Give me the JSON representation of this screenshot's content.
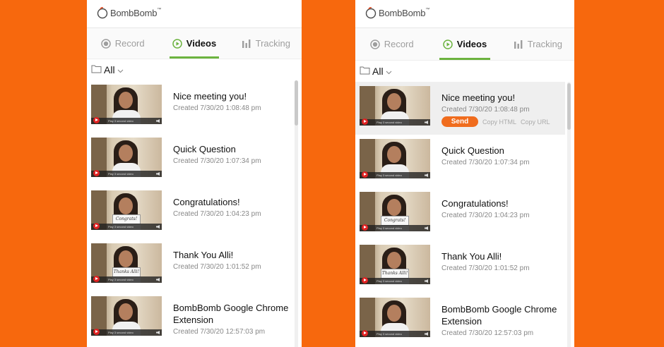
{
  "brand": {
    "name": "BombBomb",
    "trademark": "™"
  },
  "tabs": [
    {
      "label": "Record",
      "icon": "record-icon"
    },
    {
      "label": "Videos",
      "icon": "play-circle-icon"
    },
    {
      "label": "Tracking",
      "icon": "bar-chart-icon"
    }
  ],
  "active_tab": "Videos",
  "filter": {
    "label": "All",
    "icon": "folder-icon"
  },
  "selected_actions": {
    "send_label": "Send",
    "copy_html_label": "Copy HTML",
    "copy_url_label": "Copy URL"
  },
  "thumbnail_bar_text": "Play 3 second video",
  "videos": [
    {
      "title": "Nice meeting you!",
      "created": "Created 7/30/20 1:08:48 pm",
      "sign": ""
    },
    {
      "title": "Quick Question",
      "created": "Created 7/30/20 1:07:34 pm",
      "sign": ""
    },
    {
      "title": "Congratulations!",
      "created": "Created 7/30/20 1:04:23 pm",
      "sign": "Congrats!"
    },
    {
      "title": "Thank You Alli!",
      "created": "Created 7/30/20 1:01:52 pm",
      "sign": "Thanks Alli!"
    },
    {
      "title": "BombBomb Google Chrome Extension",
      "created": "Created 7/30/20 12:57:03 pm",
      "sign": ""
    }
  ],
  "colors": {
    "background": "#f7680d",
    "accent_green": "#6cb33f",
    "send_orange": "#f06c1d"
  }
}
